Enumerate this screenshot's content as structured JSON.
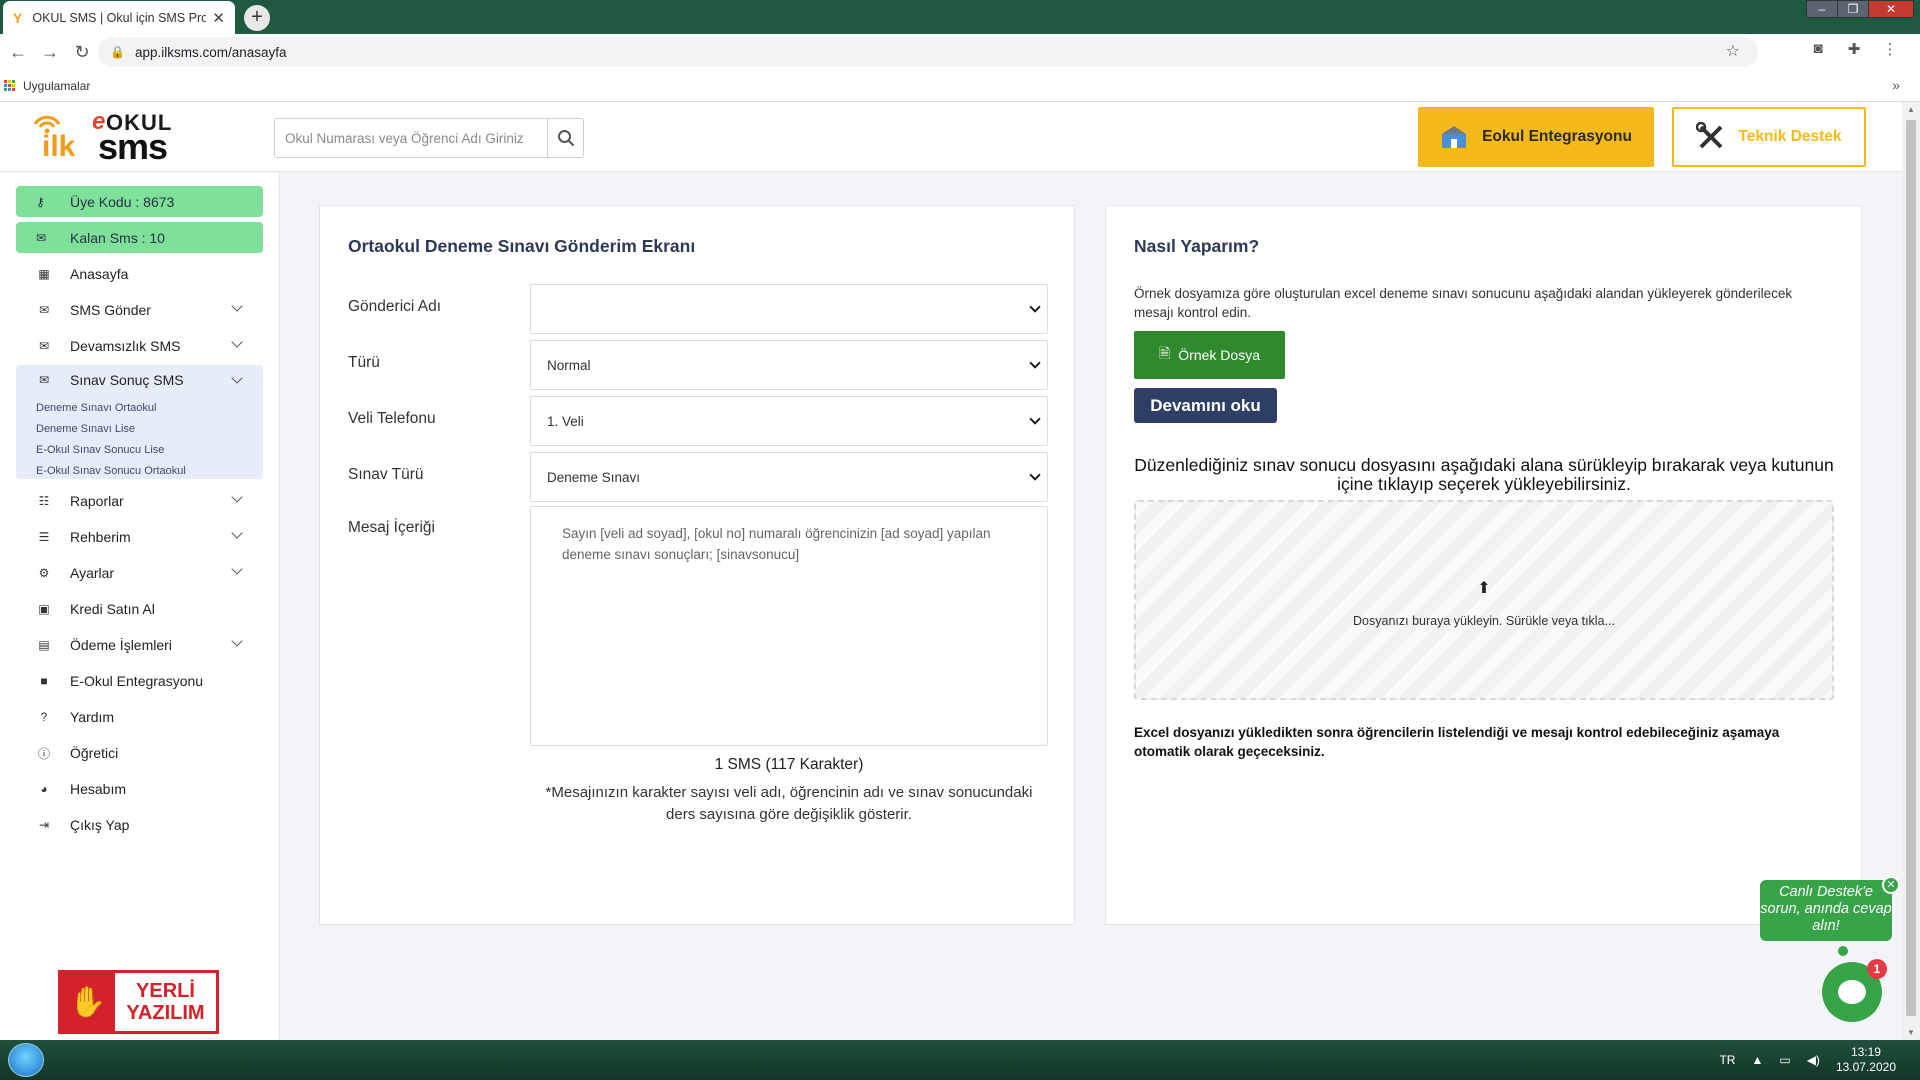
{
  "browser": {
    "tab_title": "OKUL SMS | Okul için SMS Programı",
    "tab_favicon": "Y",
    "url": "app.ilksms.com/anasayfa",
    "bookmarks_label": "Uygulamalar"
  },
  "header": {
    "logo_e": "e",
    "logo_okul": "OKUL",
    "logo_ilk": "ilk",
    "logo_sms": "sms",
    "search_placeholder": "Okul Numarası veya Öğrenci Adı Giriniz",
    "eokul_button": "Eokul Entegrasyonu",
    "teknik_button": "Teknik Destek"
  },
  "sidebar": {
    "member_code": "Üye Kodu : 8673",
    "remaining_sms": "Kalan Sms : 10",
    "items": [
      {
        "label": "Anasayfa",
        "icon": "grid-icon"
      },
      {
        "label": "SMS Gönder",
        "icon": "mail-icon"
      },
      {
        "label": "Devamsızlık SMS",
        "icon": "mail-icon"
      },
      {
        "label": "Sınav Sonuç SMS",
        "icon": "mail-icon"
      },
      {
        "label": "Raporlar",
        "icon": "list-icon"
      },
      {
        "label": "Rehberim",
        "icon": "list-icon"
      },
      {
        "label": "Ayarlar",
        "icon": "gear-icon"
      },
      {
        "label": "Kredi Satın Al",
        "icon": "money-icon"
      },
      {
        "label": "Ödeme İşlemleri",
        "icon": "card-icon"
      },
      {
        "label": "E-Okul Entegrasyonu",
        "icon": "folder-icon"
      },
      {
        "label": "Yardım",
        "icon": "question-icon"
      },
      {
        "label": "Öğretici",
        "icon": "info-icon"
      },
      {
        "label": "Hesabım",
        "icon": "user-icon"
      },
      {
        "label": "Çıkış Yap",
        "icon": "logout-icon"
      }
    ],
    "submenu": [
      "Deneme Sınavı Ortaokul",
      "Deneme Sınavı Lise",
      "E-Okul Sınav Sonucu Lise",
      "E-Okul Sınav Sonucu Ortaokul"
    ],
    "badge_yerli": "YERLİ",
    "badge_yazilim": "YAZILIM"
  },
  "form": {
    "title": "Ortaokul Deneme Sınavı Gönderim Ekranı",
    "sender_label": "Gönderici Adı",
    "sender_value": "",
    "type_label": "Türü",
    "type_value": "Normal",
    "phone_label": "Veli Telefonu",
    "phone_value": "1. Veli",
    "exam_label": "Sınav Türü",
    "exam_value": "Deneme Sınavı",
    "message_label": "Mesaj İçeriği",
    "message_text": "Sayın [veli ad soyad], [okul no] numaralı öğrencinizin [ad soyad] yapılan deneme sınavı sonuçları; [sinavsonucu]",
    "sms_count": "1 SMS (117 Karakter)",
    "note": "*Mesajınızın karakter sayısı veli adı, öğrencinin adı ve sınav sonucundaki ders sayısına göre değişiklik gösterir."
  },
  "help": {
    "title": "Nasıl Yaparım?",
    "description": "Örnek dosyamıza göre oluşturulan excel deneme sınavı sonucunu aşağıdaki alandan yükleyerek gönderilecek mesajı kontrol edin.",
    "sample_button": "Örnek Dosya",
    "read_more_button": "Devamını oku",
    "drop_instruction": "Düzenlediğiniz sınav sonucu dosyasını aşağıdaki alana sürükleyip bırakarak veya kutunun içine tıklayıp seçerek yükleyebilirsiniz.",
    "dropzone_text": "Dosyanızı buraya yükleyin. Sürükle veya tıkla...",
    "footer_text": "Excel dosyanızı yükledikten sonra öğrencilerin listelendiği ve mesajı kontrol edebileceğiniz aşamaya otomatik olarak geçeceksiniz."
  },
  "chat": {
    "bubble_text": "Canlı Destek'e sorun, anında cevap alın!",
    "badge_count": "1"
  },
  "taskbar": {
    "lang": "TR",
    "time": "13:19",
    "date": "13.07.2020"
  },
  "colors": {
    "accent_green": "#7fe09a",
    "eokul_yellow": "#f5b91a",
    "sample_green": "#2f8a2e",
    "navy": "#2f3e64",
    "chat_green": "#37a447"
  }
}
